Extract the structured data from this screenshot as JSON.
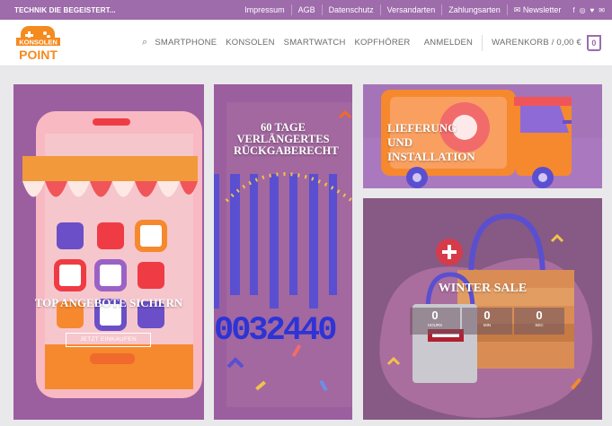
{
  "topbar": {
    "tagline": "TECHNIK DIE BEGEISTERT...",
    "links": [
      "Impressum",
      "AGB",
      "Datenschutz",
      "Versandarten",
      "Zahlungsarten",
      "Newsletter"
    ],
    "social_icons": [
      "facebook-icon",
      "instagram-icon",
      "twitter-icon",
      "email-icon"
    ]
  },
  "header": {
    "logo_top": "KONSOLEN",
    "logo_bottom": "POINT",
    "nav": [
      "SMARTPHONE",
      "KONSOLEN",
      "SMARTWATCH",
      "KOPFHÖRER"
    ],
    "login": "ANMELDEN",
    "cart_label": "WARENKORB / 0,00 €",
    "cart_count": "0"
  },
  "tiles": {
    "top_offers": {
      "title": "TOP ANGEBOTE SICHERN",
      "cta": "JETZT EINKAUFEN"
    },
    "returns": {
      "title": "60 TAGE VERLÄNGERTES RÜCKGABERECHT",
      "number": "0032440"
    },
    "delivery": {
      "title_line1": "LIEFERUNG",
      "title_line2": "UND",
      "title_line3": "INSTALLATION"
    },
    "winter": {
      "title": "WINTER SALE",
      "countdown": [
        {
          "value": "0",
          "unit": "Hours"
        },
        {
          "value": "0",
          "unit": "Min"
        },
        {
          "value": "0",
          "unit": "Sec"
        }
      ]
    }
  },
  "colors": {
    "brand_purple": "#9e6bab",
    "logo_orange": "#f58a1f"
  }
}
